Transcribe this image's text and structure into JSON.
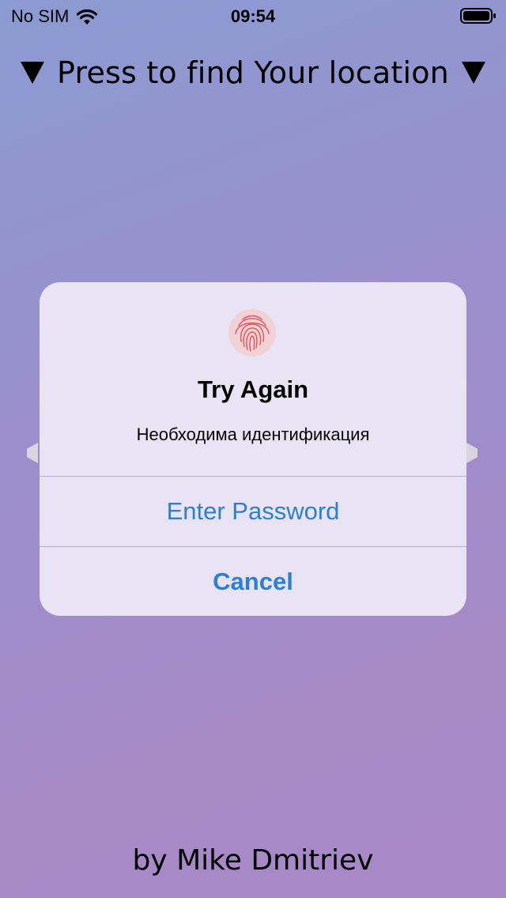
{
  "status_bar": {
    "carrier": "No SIM",
    "time": "09:54",
    "wifi_icon": "wifi-icon",
    "battery_icon": "battery-icon"
  },
  "header": {
    "text": "Press to find Your location",
    "left_icon": "triangle-down-icon",
    "right_icon": "triangle-down-icon"
  },
  "dialog": {
    "icon": "fingerprint-icon",
    "icon_color": "#e05a63",
    "title": "Try Again",
    "message": "Необходима идентификация",
    "buttons": [
      {
        "label": "Enter Password"
      },
      {
        "label": "Cancel"
      }
    ],
    "button_color": "#2d7fd6"
  },
  "footer": {
    "text": "by Mike Dmitriev"
  }
}
